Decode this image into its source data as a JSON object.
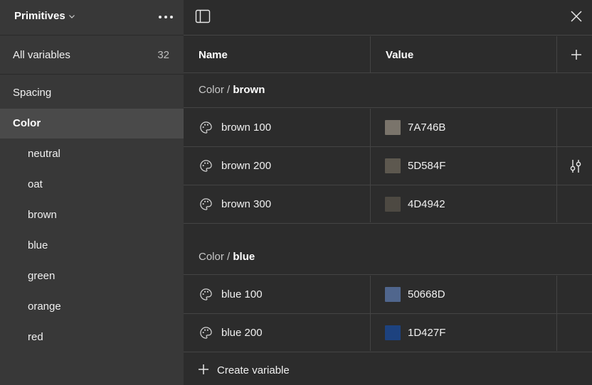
{
  "sidebar": {
    "collection_title": "Primitives",
    "all_variables_label": "All variables",
    "all_variables_count": "32",
    "groups": [
      {
        "label": "Spacing"
      },
      {
        "label": "Color"
      },
      {
        "label": "neutral"
      },
      {
        "label": "oat"
      },
      {
        "label": "brown"
      },
      {
        "label": "blue"
      },
      {
        "label": "green"
      },
      {
        "label": "orange"
      },
      {
        "label": "red"
      }
    ],
    "active_group": "Color"
  },
  "table": {
    "col_name": "Name",
    "col_value": "Value",
    "groups": [
      {
        "prefix": "Color / ",
        "name": "brown",
        "rows": [
          {
            "name": "brown 100",
            "hex": "7A746B",
            "swatch": "#7a746b"
          },
          {
            "name": "brown 200",
            "hex": "5D584F",
            "swatch": "#5d584f"
          },
          {
            "name": "brown 300",
            "hex": "4D4942",
            "swatch": "#4d4942"
          }
        ]
      },
      {
        "prefix": "Color / ",
        "name": "blue",
        "rows": [
          {
            "name": "blue 100",
            "hex": "50668D",
            "swatch": "#50668d"
          },
          {
            "name": "blue 200",
            "hex": "1D427F",
            "swatch": "#1d427f"
          }
        ]
      }
    ],
    "create_label": "Create variable"
  },
  "colors": {
    "sidebar_bg": "#383838",
    "main_bg": "#2c2c2c",
    "active_bg": "#4a4a4a",
    "border": "#444444"
  }
}
